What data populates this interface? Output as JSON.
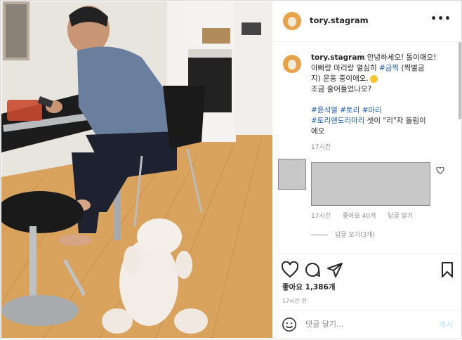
{
  "post": {
    "username": "tory.stagram",
    "more_icon": "more-dots-icon"
  },
  "caption": {
    "username": "tory.stagram",
    "text_line1": " 안녕하세오! 톨이애오!",
    "text_line2a": "아빠랑 마리랑 열심히 ",
    "tag_highlight": "#금찍",
    "text_line2b": " (찍별금",
    "text_line3": "지) 운동 중이애오.",
    "text_line4": "조금 줄어들었나오?",
    "tags_line1": "#윤석열 #토리 #마리",
    "tags_line2a": "#토리앤도리마리",
    "tags_line2b": " 셋이 \"리\"자 돌림이",
    "tags_line3": "에오",
    "time": "17시간"
  },
  "comment": {
    "time": "17시간",
    "likes": "좋아요 40개",
    "reply": "답글 달기",
    "view_replies": "답글 보기(3개)"
  },
  "actions": {
    "likes": "좋아요 1,386개",
    "ago": "17시간 전"
  },
  "composer": {
    "placeholder": "댓글 달기...",
    "post_label": "게시"
  }
}
